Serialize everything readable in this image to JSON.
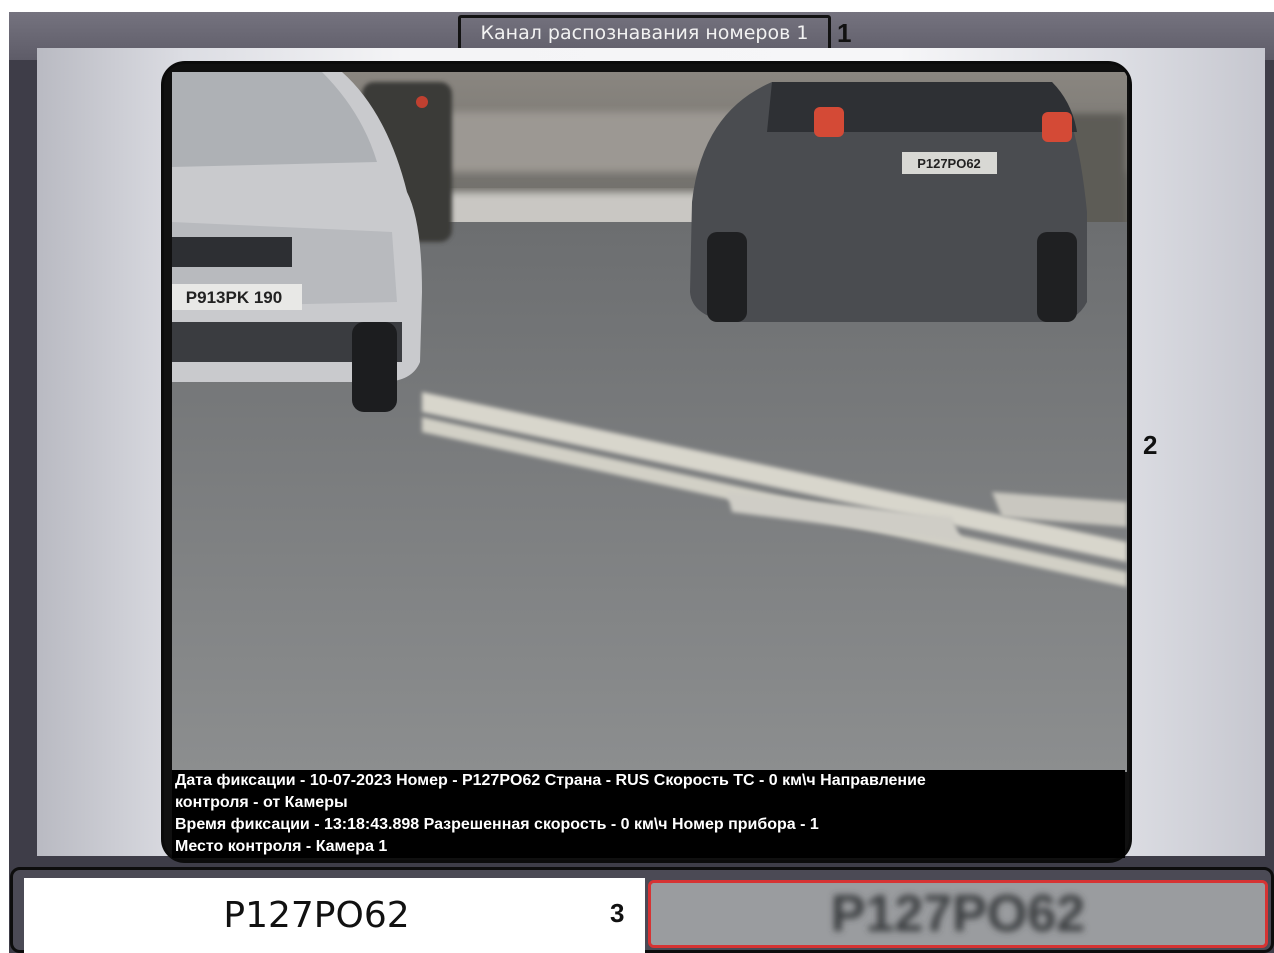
{
  "window": {
    "title": "Канал распознавания номеров 1"
  },
  "callouts": {
    "one": "1",
    "two": "2",
    "three": "3"
  },
  "video": {
    "vehicle_plate_left": "P913PK 190",
    "vehicle_plate_right": "P127PO62",
    "overlay": {
      "line1": "Дата фиксации - 10-07-2023 Номер - P127PO62     Страна - RUS Скорость ТС - 0 км\\ч Направление",
      "line2": "контроля - от Камеры",
      "line3": "Время фиксации - 13:18:43.898       Разрешенная скорость - 0 км\\ч       Номер прибора - 1",
      "line4": "Место контроля - Камера 1"
    }
  },
  "result": {
    "plate_number": "P127PO62",
    "plate_image_text": "P127PO62"
  },
  "colors": {
    "window_bg": "#3e3d48",
    "highlight_border": "#d63333"
  }
}
